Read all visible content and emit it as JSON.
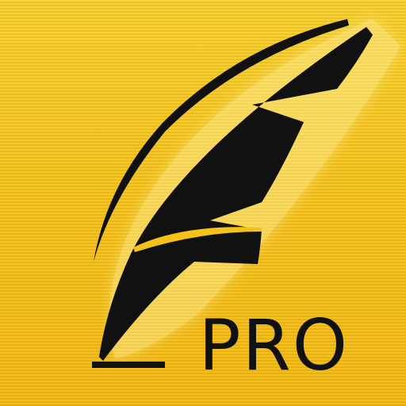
{
  "icon": {
    "label": "PRO",
    "logo": "feather-quill",
    "colors": {
      "background": "#f5c21a",
      "ink": "#111111",
      "glow": "#fff6b0"
    }
  }
}
